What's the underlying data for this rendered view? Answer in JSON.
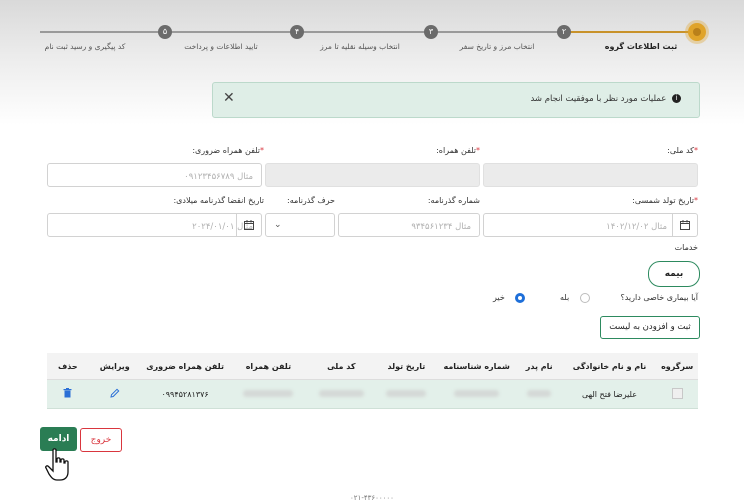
{
  "stepper": {
    "steps": [
      {
        "num": "۱",
        "label": "ثبت اطلاعات گروه"
      },
      {
        "num": "۲",
        "label": "انتخاب مرز و تاریخ سفر"
      },
      {
        "num": "۳",
        "label": "انتخاب وسیله نقلیه تا مرز"
      },
      {
        "num": "۴",
        "label": "تایید اطلاعات و پرداخت"
      },
      {
        "num": "۵",
        "label": "کد پیگیری و رسید ثبت نام"
      }
    ],
    "active_color": "#e0a42a"
  },
  "alert": {
    "message": "عملیات مورد نظر با موفقیت انجام شد",
    "info_icon": "i",
    "close_icon": "✕"
  },
  "form": {
    "national_code": {
      "label": "کد ملی:",
      "required": "*"
    },
    "mobile": {
      "label": "تلفن همراه:",
      "required": "*"
    },
    "emergency_phone": {
      "label": "تلفن همراه ضروری:",
      "required": "*",
      "placeholder": "مثال ۰۹۱۲۳۴۵۶۷۸۹"
    },
    "birth_date": {
      "label": "تاریخ تولد شمسی:",
      "required": "*",
      "placeholder": "مثال ۱۴۰۲/۱۲/۰۲"
    },
    "passport_number": {
      "label": "شماره گذرنامه:",
      "placeholder": "مثال ۹۳۴۵۶۱۲۳۴"
    },
    "passport_letter": {
      "label": "حرف گذرنامه:"
    },
    "passport_expiry": {
      "label": "تاریخ انقضا گذرنامه میلادی:",
      "placeholder": "مثال ۲۰۲۴/۰۱/۰۱"
    },
    "services_label": "خدمات",
    "insurance_button": "بیمه",
    "disease_question": "آیا بیماری خاصی دارید؟",
    "radio_yes": "بله",
    "radio_no": "خیر",
    "add_to_list_button": "ثبت و افزودن به لیست"
  },
  "table": {
    "headers": [
      "سرگروه",
      "نام و نام خانوادگی",
      "نام پدر",
      "شماره شناسنامه",
      "تاریخ تولد",
      "کد ملی",
      "تلفن همراه",
      "تلفن همراه ضروری",
      "ویرایش",
      "حذف"
    ],
    "rows": [
      {
        "name": "علیرضا فتح الهی",
        "emergency_phone": "۰۹۹۴۵۲۸۱۳۷۶"
      }
    ]
  },
  "actions": {
    "continue_button": "ادامه",
    "exit_button": "خروج"
  },
  "footer": {
    "text": "۰۲۱-۴۳۶۰۰۰۰۰"
  },
  "colors": {
    "primary": "#2a7d54",
    "danger": "#d9363e",
    "alert_bg": "#dfeee7",
    "row_bg": "#e3f0ea"
  }
}
